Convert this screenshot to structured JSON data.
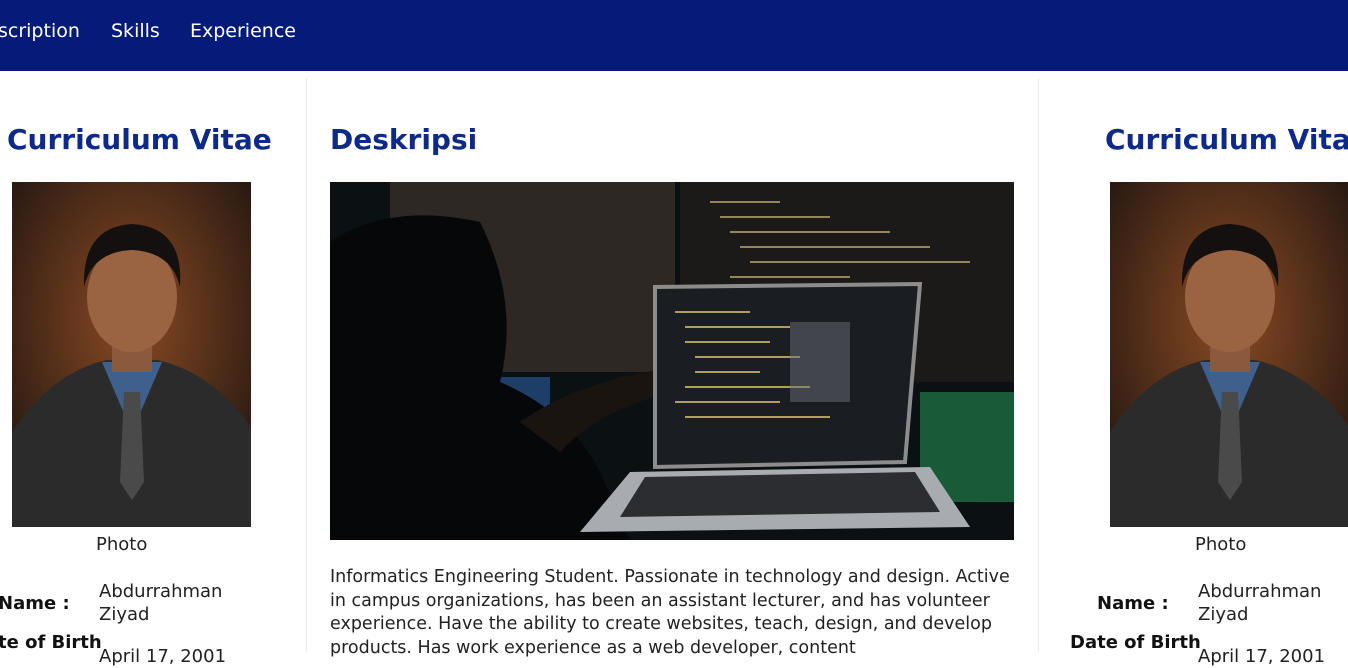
{
  "nav": {
    "items": [
      "scription",
      "Skills",
      "Experience"
    ]
  },
  "left_cv": {
    "title": "Curriculum Vitae",
    "photo_caption": "Photo",
    "name_label": "Name :",
    "name_value": "Abdurrahman Ziyad",
    "dob_label": "te of Birth",
    "dob_value": "April 17, 2001"
  },
  "description": {
    "title": "Deskripsi",
    "text": "Informatics Engineering Student. Passionate in technology and design. Active in campus organizations, has been an assistant lecturer, and has volunteer experience. Have the ability to create websites, teach, design, and develop products. Has work experience as a web developer, content"
  },
  "right_cv": {
    "title": "Curriculum Vitae",
    "photo_caption": "Photo",
    "name_label": "Name :",
    "name_value": "Abdurrahman Ziyad",
    "dob_label": "Date of Birth",
    "dob_value": "April 17, 2001"
  },
  "colors": {
    "navbar": "#061a7a",
    "heading": "#0d2a8a"
  }
}
